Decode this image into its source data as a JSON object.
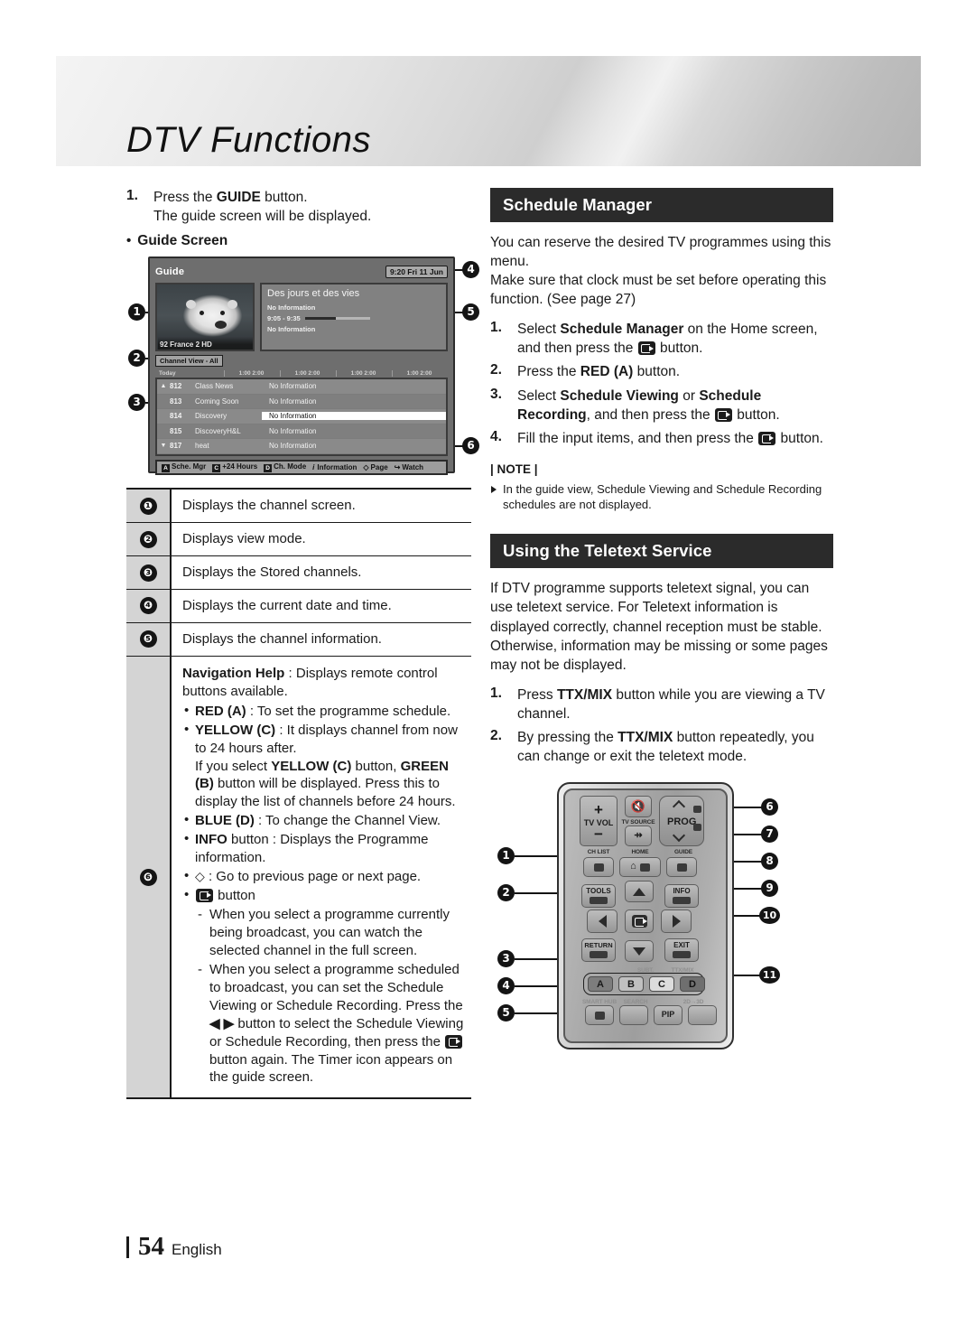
{
  "header": {
    "title": "DTV Functions"
  },
  "left": {
    "step1": {
      "num": "1.",
      "line1_a": "Press the ",
      "line1_b": "GUIDE",
      "line1_c": " button.",
      "line2": "The guide screen will be displayed."
    },
    "guide_bullet": "Guide Screen",
    "guide_screen": {
      "title": "Guide",
      "clock": "9:20 Fri 11 Jun",
      "thumb_channel": "92 France 2 HD",
      "programme": "Des jours et des vies",
      "info_line1": "No Information",
      "time_range": "9:05 - 9:35",
      "info_line2": "No Information",
      "channel_view": "Channel View - All",
      "today_label": "Today",
      "time_slots": [
        "1:00   2:00",
        "1:00   2:00",
        "1:00   2:00",
        "1:00   2:00"
      ],
      "rows": [
        {
          "arrow": "▲",
          "number": "812",
          "name": "Class News",
          "info": "No Information",
          "selected": false
        },
        {
          "arrow": "",
          "number": "813",
          "name": "Coming Soon",
          "info": "No Information",
          "selected": false
        },
        {
          "arrow": "",
          "number": "814",
          "name": "Discovery",
          "info": "No Information",
          "selected": true
        },
        {
          "arrow": "",
          "number": "815",
          "name": "DiscoveryH&L",
          "info": "No Information",
          "selected": false
        },
        {
          "arrow": "▼",
          "number": "817",
          "name": "heat",
          "info": "No Information",
          "selected": false
        }
      ],
      "navbar": [
        {
          "key": "A",
          "label": "Sche. Mgr"
        },
        {
          "key": "C",
          "label": "+24 Hours"
        },
        {
          "key": "D",
          "label": "Ch. Mode"
        },
        {
          "key": "i",
          "label": "Information"
        },
        {
          "key": "◇",
          "label": "Page"
        },
        {
          "key": "↪",
          "label": "Watch"
        }
      ],
      "callouts": [
        "1",
        "2",
        "3",
        "4",
        "5",
        "6"
      ]
    },
    "descriptions": [
      {
        "num": "❶",
        "text": "Displays the channel screen."
      },
      {
        "num": "❷",
        "text": "Displays view mode."
      },
      {
        "num": "❸",
        "text": "Displays the Stored channels."
      },
      {
        "num": "❹",
        "text": "Displays the current date and time."
      },
      {
        "num": "❺",
        "text": "Displays the channel information."
      }
    ],
    "nav_help": {
      "num": "❻",
      "heading_bold": "Navigation Help",
      "heading_rest": " : Displays remote control buttons available.",
      "items": [
        {
          "bold": "RED (A)",
          "rest": " : To set the programme schedule."
        },
        {
          "bold": "YELLOW (C)",
          "rest": " : It displays channel from now to 24 hours after."
        },
        {
          "bold": "BLUE (D)",
          "rest": " : To change the Channel View."
        },
        {
          "bold": "INFO",
          "rest": " button : Displays the Programme information."
        }
      ],
      "yellow_extra_1": "If you select ",
      "yellow_extra_b1": "YELLOW (C)",
      "yellow_extra_2": " button, ",
      "yellow_extra_b2": "GREEN (B)",
      "yellow_extra_3": " button will be displayed. Press this to display the list of channels before 24 hours.",
      "page_item": " : Go to previous page or next page.",
      "enter_item": " button",
      "sub1": "When you select a programme currently being broadcast, you can watch the selected channel in the full screen.",
      "sub2_a": "When you select a programme scheduled to broadcast, you can set the Schedule Viewing or Schedule Recording. Press the ",
      "sub2_arrows": "◀ ▶",
      "sub2_b": " button to select the Schedule Viewing or Schedule Recording, then press the ",
      "sub2_c": " button again. The Timer icon appears on the guide screen."
    }
  },
  "right": {
    "schedule_manager": {
      "heading": "Schedule Manager",
      "para1": "You can reserve the desired TV programmes using this menu.",
      "para2": "Make sure that clock must be set before operating this function. (See page 27)",
      "steps": [
        {
          "num": "1.",
          "a": "Select ",
          "b": "Schedule Manager",
          "c": " on the Home screen, and then press the ",
          "icon": true,
          "d": " button."
        },
        {
          "num": "2.",
          "a": "Press the ",
          "b": "RED (A)",
          "c": " button.",
          "icon": false,
          "d": ""
        },
        {
          "num": "3.",
          "a": "Select ",
          "b": "Schedule Viewing",
          "mid": " or ",
          "b2": "Schedule Recording",
          "c": ", and then press the ",
          "icon": true,
          "d": " button."
        },
        {
          "num": "4.",
          "a": "Fill the input items, and then press the ",
          "b": "",
          "c": "",
          "icon": true,
          "d": " button."
        }
      ],
      "note_title": "| NOTE |",
      "note_item": "In the guide view, Schedule Viewing and Schedule Recording schedules are not displayed."
    },
    "teletext": {
      "heading": "Using the Teletext Service",
      "para": "If DTV programme supports teletext signal, you can use teletext service. For Teletext information is displayed correctly, channel reception must be stable. Otherwise, information may be missing or some pages may not be displayed.",
      "steps": [
        {
          "num": "1.",
          "a": "Press ",
          "b": "TTX/MIX",
          "c": " button while you are viewing a TV channel."
        },
        {
          "num": "2.",
          "a": "By pressing the ",
          "b": "TTX/MIX",
          "c": " button repeatedly, you can change or exit the teletext mode."
        }
      ]
    },
    "remote": {
      "labels": {
        "tv_vol": "TV VOL",
        "tv_source": "TV SOURCE",
        "prog": "PROG",
        "ch_list": "CH LIST",
        "home": "HOME",
        "guide": "GUIDE",
        "tools": "TOOLS",
        "info": "INFO",
        "return": "RETURN",
        "exit": "EXIT",
        "plus": "+",
        "minus": "−",
        "smart_hub": "SMART HUB",
        "search": "SEARCH",
        "pip": "PIP",
        "conv2d3d": "2D→3D",
        "subt": "SUBT.",
        "ttx_mix": "TTX/MIX"
      },
      "color_buttons": [
        "A",
        "B",
        "C",
        "D"
      ],
      "callouts_left": [
        "1",
        "2",
        "3",
        "4",
        "5"
      ],
      "callouts_right": [
        "6",
        "7",
        "8",
        "9",
        "10",
        "11"
      ]
    }
  },
  "footer": {
    "page_number": "54",
    "language": "English"
  }
}
